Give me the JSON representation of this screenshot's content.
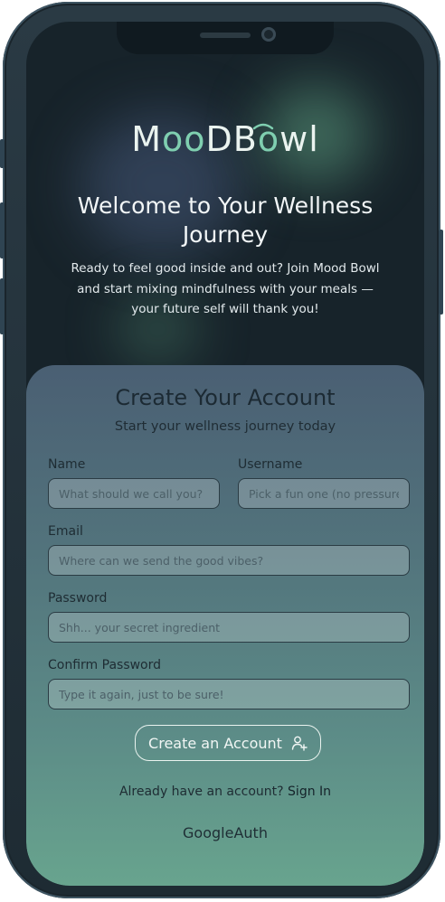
{
  "logo": {
    "part1": "M",
    "part2": "oo",
    "part3": "DB",
    "part4": "o",
    "part5": "wl"
  },
  "hero": {
    "title": "Welcome to Your Wellness Journey",
    "text": "Ready to feel good inside and out? Join Mood Bowl and start mixing mindfulness with your meals — your future self will thank you!"
  },
  "form": {
    "title": "Create Your Account",
    "subtitle": "Start your wellness journey today",
    "name_label": "Name",
    "name_placeholder": "What should we call you?",
    "username_label": "Username",
    "username_placeholder": "Pick a fun one (no pressure)",
    "email_label": "Email",
    "email_placeholder": "Where can we send the good vibes?",
    "password_label": "Password",
    "password_placeholder": "Shh... your secret ingredient",
    "confirm_label": "Confirm Password",
    "confirm_placeholder": "Type it again, just to be sure!",
    "submit_label": "Create an Account",
    "submit_icon": "user-plus-icon",
    "signin_prompt": "Already have an account?",
    "signin_link": "Sign In",
    "google_label": "GoogleAuth"
  },
  "colors": {
    "screen_bg": "#17232a",
    "accent_green": "#7fcfb0",
    "card_top": "#4a5f73",
    "card_bottom": "#68a48e"
  }
}
